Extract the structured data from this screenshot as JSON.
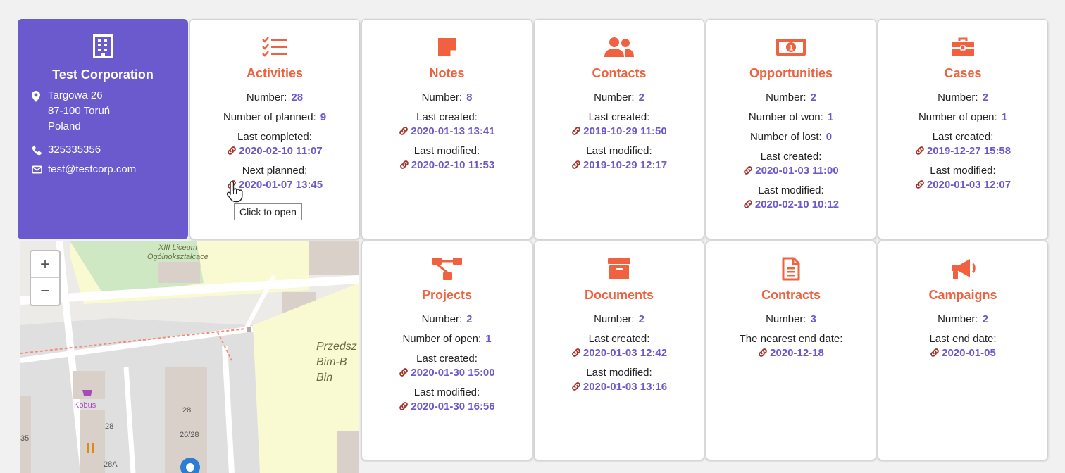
{
  "company": {
    "name": "Test Corporation",
    "address_line1": "Targowa 26",
    "address_line2": "87-100 Toruń",
    "address_line3": "Poland",
    "phone": "325335356",
    "email": "test@testcorp.com"
  },
  "activities": {
    "title": "Activities",
    "number_label": "Number:",
    "number": "28",
    "planned_label": "Number of planned:",
    "planned": "9",
    "last_completed_label": "Last completed:",
    "last_completed": "2020-02-10 11:07",
    "next_planned_label": "Next planned:",
    "next_planned": "2020-01-07 13:45"
  },
  "notes": {
    "title": "Notes",
    "number_label": "Number:",
    "number": "8",
    "last_created_label": "Last created:",
    "last_created": "2020-01-13 13:41",
    "last_modified_label": "Last modified:",
    "last_modified": "2020-02-10 11:53"
  },
  "contacts": {
    "title": "Contacts",
    "number_label": "Number:",
    "number": "2",
    "last_created_label": "Last created:",
    "last_created": "2019-10-29 11:50",
    "last_modified_label": "Last modified:",
    "last_modified": "2019-10-29 12:17"
  },
  "opportunities": {
    "title": "Opportunities",
    "number_label": "Number:",
    "number": "2",
    "won_label": "Number of won:",
    "won": "1",
    "lost_label": "Number of lost:",
    "lost": "0",
    "last_created_label": "Last created:",
    "last_created": "2020-01-03 11:00",
    "last_modified_label": "Last modified:",
    "last_modified": "2020-02-10 10:12"
  },
  "cases": {
    "title": "Cases",
    "number_label": "Number:",
    "number": "2",
    "open_label": "Number of open:",
    "open": "1",
    "last_created_label": "Last created:",
    "last_created": "2019-12-27 15:58",
    "last_modified_label": "Last modified:",
    "last_modified": "2020-01-03 12:07"
  },
  "projects": {
    "title": "Projects",
    "number_label": "Number:",
    "number": "2",
    "open_label": "Number of open:",
    "open": "1",
    "last_created_label": "Last created:",
    "last_created": "2020-01-30 15:00",
    "last_modified_label": "Last modified:",
    "last_modified": "2020-01-30 16:56"
  },
  "documents": {
    "title": "Documents",
    "number_label": "Number:",
    "number": "2",
    "last_created_label": "Last created:",
    "last_created": "2020-01-03 12:42",
    "last_modified_label": "Last modified:",
    "last_modified": "2020-01-03 13:16"
  },
  "contracts": {
    "title": "Contracts",
    "number_label": "Number:",
    "number": "3",
    "end_label": "The nearest end date:",
    "end": "2020-12-18"
  },
  "campaigns": {
    "title": "Campaigns",
    "number_label": "Number:",
    "number": "2",
    "end_label": "Last end date:",
    "end": "2020-01-05"
  },
  "map": {
    "zoom_in": "+",
    "zoom_out": "−",
    "labels": {
      "school1": "XIII Liceum",
      "school2": "Ogólnokształcące",
      "kindergarten1": "Przedsz",
      "kindergarten2": "Bim-B",
      "kindergarten3": "Bin",
      "shop": "Kobus",
      "num1": "28",
      "num2": "28",
      "num3": "26/28",
      "num4": "28A",
      "num5": "35"
    }
  },
  "tooltip": "Click to open",
  "colors": {
    "accent": "#f0623f",
    "brand": "#6a5acd",
    "link_icon": "#a0372e"
  }
}
